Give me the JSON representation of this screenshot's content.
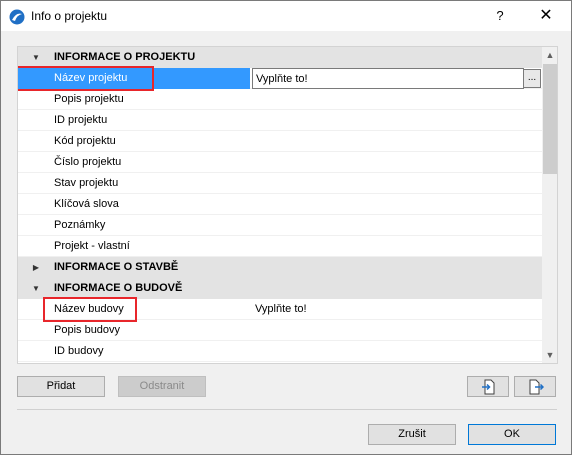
{
  "window": {
    "title": "Info o projektu",
    "help_label": "?",
    "close_label": "✕"
  },
  "tree": {
    "groups": [
      {
        "label": "INFORMACE O PROJEKTU",
        "expanded": true,
        "items": [
          {
            "name": "Název projektu",
            "value": "Vyplňte to!",
            "selected": true
          },
          {
            "name": "Popis projektu",
            "value": ""
          },
          {
            "name": "ID projektu",
            "value": ""
          },
          {
            "name": "Kód projektu",
            "value": ""
          },
          {
            "name": "Číslo projektu",
            "value": ""
          },
          {
            "name": "Stav projektu",
            "value": ""
          },
          {
            "name": "Klíčová slova",
            "value": ""
          },
          {
            "name": "Poznámky",
            "value": ""
          },
          {
            "name": "Projekt - vlastní",
            "value": ""
          }
        ]
      },
      {
        "label": "INFORMACE O STAVBĚ",
        "expanded": false,
        "items": []
      },
      {
        "label": "INFORMACE O BUDOVĚ",
        "expanded": true,
        "items": [
          {
            "name": "Název budovy",
            "value": "Vyplňte to!"
          },
          {
            "name": "Popis budovy",
            "value": ""
          },
          {
            "name": "ID budovy",
            "value": ""
          }
        ]
      }
    ],
    "browse_label": "..."
  },
  "actions": {
    "add_label": "Přidat",
    "remove_label": "Odstranit",
    "import_icon": "import-file-icon",
    "export_icon": "export-file-icon"
  },
  "footer": {
    "cancel_label": "Zrušit",
    "ok_label": "OK"
  },
  "colors": {
    "selection": "#3399ff",
    "highlight": "#e8262b",
    "group_bg": "#e3e3e3"
  }
}
